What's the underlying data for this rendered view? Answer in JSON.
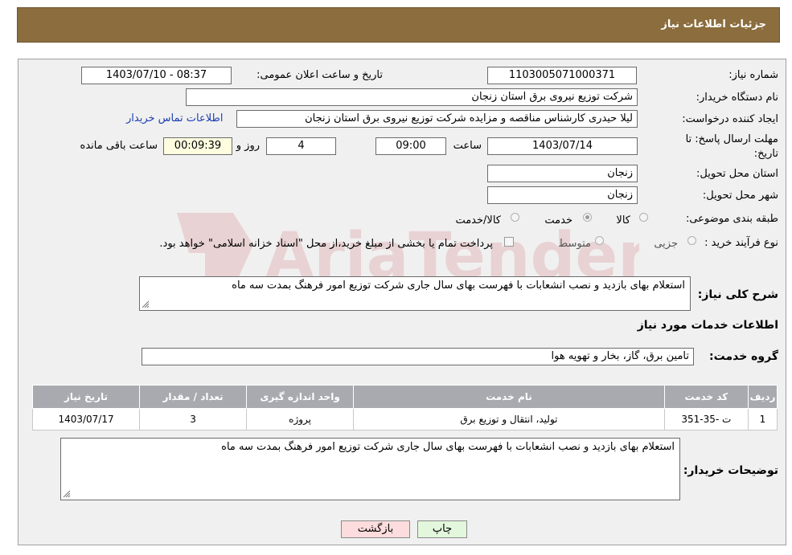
{
  "header": {
    "title": "جزئیات اطلاعات نیاز"
  },
  "form": {
    "need_number": {
      "label": "شماره نیاز:",
      "value": "1103005071000371"
    },
    "announce_datetime": {
      "label": "تاریخ و ساعت اعلان عمومی:",
      "value": "1403/07/10 - 08:37"
    },
    "buyer_org": {
      "label": "نام دستگاه خریدار:",
      "value": "شرکت توزیع نیروی برق استان زنجان"
    },
    "requester": {
      "label": "ایجاد کننده درخواست:",
      "value": "لیلا حیدری کارشناس مناقصه و مزایده شرکت توزیع نیروی برق استان زنجان",
      "contact_link": "اطلاعات تماس خریدار"
    },
    "deadline": {
      "label": "مهلت ارسال پاسخ: تا تاریخ:",
      "date": "1403/07/14",
      "time_label": "ساعت",
      "time": "09:00",
      "days": "4",
      "days_label": "روز و",
      "remaining": "00:09:39",
      "remaining_label": "ساعت باقی مانده"
    },
    "province": {
      "label": "استان محل تحویل:",
      "value": "زنجان"
    },
    "city": {
      "label": "شهر محل تحویل:",
      "value": "زنجان"
    },
    "category": {
      "label": "طبقه بندی موضوعی:",
      "options": [
        "کالا",
        "خدمت",
        "کالا/خدمت"
      ],
      "selected": "خدمت"
    },
    "purchase_type": {
      "label": "نوع فرآیند خرید :",
      "options": [
        "جزیی",
        "متوسط"
      ],
      "note": "پرداخت تمام یا بخشی از مبلغ خرید،از محل \"اسناد خزانه اسلامی\" خواهد بود."
    },
    "summary": {
      "label": "شرح کلی نیاز:",
      "value": "استعلام بهای بازدید و نصب انشعابات با فهرست بهای سال جاری شرکت توزیع امور فرهنگ بمدت سه ماه"
    },
    "services_title": "اطلاعات خدمات مورد نیاز",
    "service_group": {
      "label": "گروه خدمت:",
      "value": "تامین برق، گاز، بخار و تهویه هوا"
    }
  },
  "table": {
    "headers": [
      "ردیف",
      "کد خدمت",
      "نام خدمت",
      "واحد اندازه گیری",
      "تعداد / مقدار",
      "تاریخ نیاز"
    ],
    "rows": [
      [
        "1",
        "ت -35-351",
        "تولید، انتقال و توزیع برق",
        "پروژه",
        "3",
        "1403/07/17"
      ]
    ]
  },
  "buyer_notes": {
    "label": "توضیحات خریدار:",
    "value": "استعلام بهای بازدید و نصب انشعابات با فهرست بهای سال جاری شرکت توزیع امور فرهنگ بمدت سه ماه"
  },
  "buttons": {
    "print": "چاپ",
    "back": "بازگشت"
  },
  "watermark": {
    "text": "AriaTender.neT",
    "color": "#b01515"
  },
  "colors": {
    "header_bg": "#8b6d3e",
    "panel_bg": "#f1f0f1",
    "table_header_bg": "#a9aab0",
    "back_btn_bg": "#fcdcdc",
    "print_btn_bg": "#e2f7dc",
    "link": "#1a3fb0"
  }
}
